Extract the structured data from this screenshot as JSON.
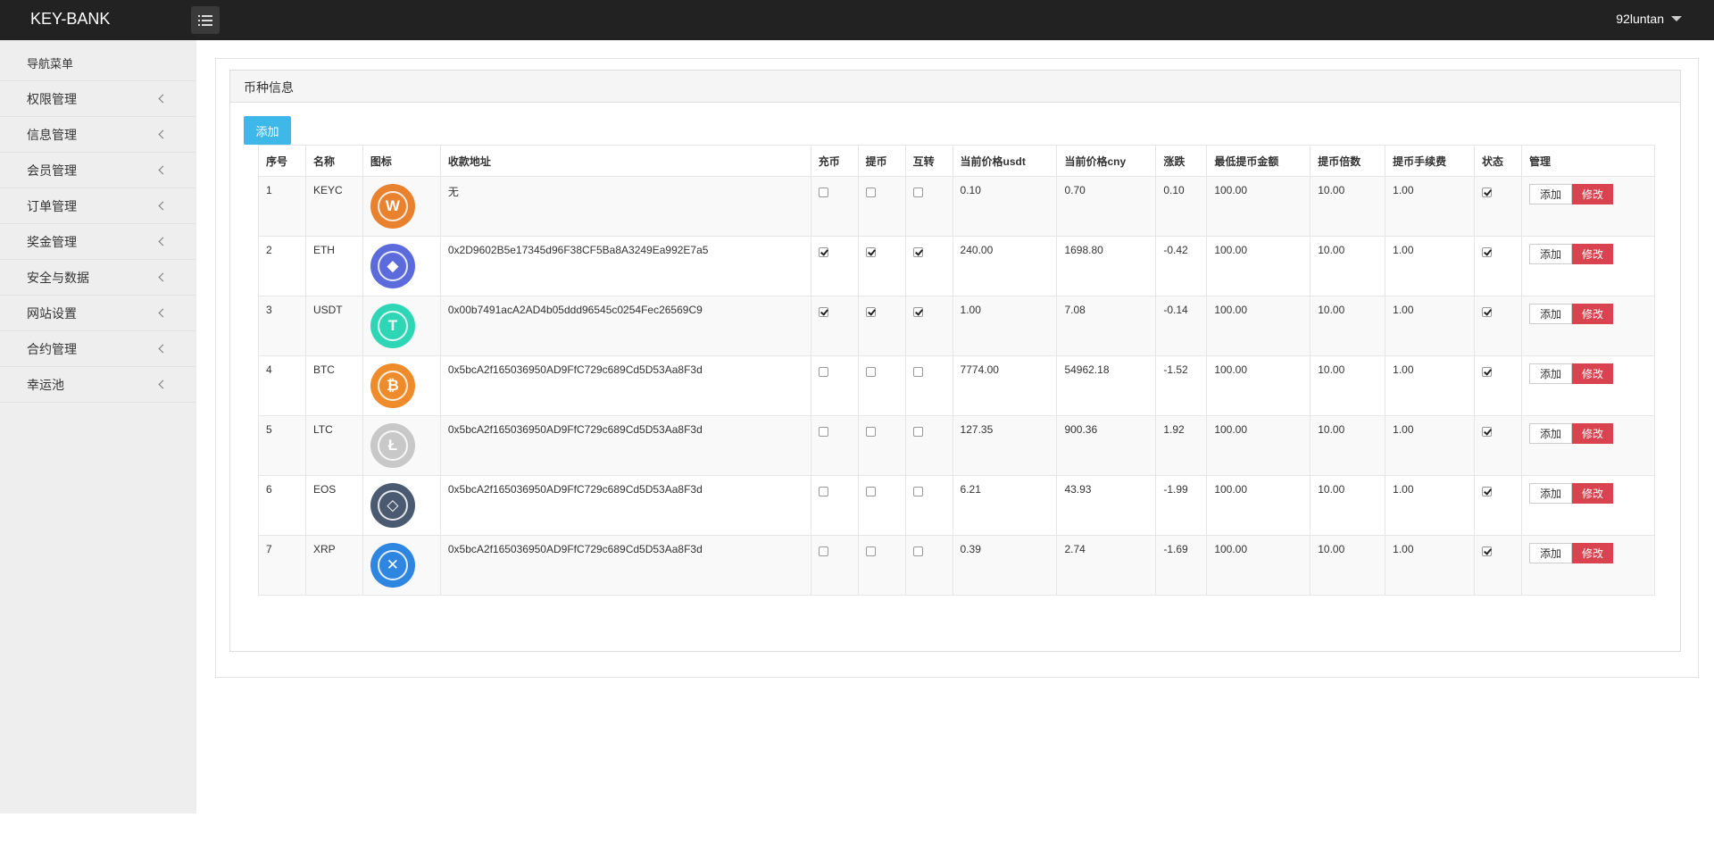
{
  "header": {
    "brand": "KEY-BANK",
    "user": "92luntan"
  },
  "sidebar": {
    "title": "导航菜单",
    "items": [
      {
        "label": "权限管理"
      },
      {
        "label": "信息管理"
      },
      {
        "label": "会员管理"
      },
      {
        "label": "订单管理"
      },
      {
        "label": "奖金管理"
      },
      {
        "label": "安全与数据"
      },
      {
        "label": "网站设置"
      },
      {
        "label": "合约管理"
      },
      {
        "label": "幸运池"
      }
    ]
  },
  "panel": {
    "title": "币种信息",
    "add_label": "添加"
  },
  "table": {
    "columns": [
      "序号",
      "名称",
      "图标",
      "收款地址",
      "充币",
      "提币",
      "互转",
      "当前价格usdt",
      "当前价格cny",
      "涨跌",
      "最低提币金额",
      "提币倍数",
      "提币手续费",
      "状态",
      "管理"
    ],
    "add_label": "添加",
    "edit_label": "修改",
    "rows": [
      {
        "id": "1",
        "name": "KEYC",
        "icon": "keyc-coin-icon",
        "icon_glyph": "W",
        "icon_color": "#e8822e",
        "address": "无",
        "deposit": false,
        "withdraw": false,
        "transfer": false,
        "price_usdt": "0.10",
        "price_cny": "0.70",
        "change": "0.10",
        "min_withdraw": "100.00",
        "multiple": "10.00",
        "fee": "1.00",
        "status": true
      },
      {
        "id": "2",
        "name": "ETH",
        "icon": "eth-coin-icon",
        "icon_glyph": "◆",
        "icon_color": "#5c6bdb",
        "address": "0x2D9602B5e17345d96F38CF5Ba8A3249Ea992E7a5",
        "deposit": true,
        "withdraw": true,
        "transfer": true,
        "price_usdt": "240.00",
        "price_cny": "1698.80",
        "change": "-0.42",
        "min_withdraw": "100.00",
        "multiple": "10.00",
        "fee": "1.00",
        "status": true
      },
      {
        "id": "3",
        "name": "USDT",
        "icon": "usdt-coin-icon",
        "icon_glyph": "T",
        "icon_color": "#2fd6b5",
        "address": "0x00b7491acA2AD4b05ddd96545c0254Fec26569C9",
        "deposit": true,
        "withdraw": true,
        "transfer": true,
        "price_usdt": "1.00",
        "price_cny": "7.08",
        "change": "-0.14",
        "min_withdraw": "100.00",
        "multiple": "10.00",
        "fee": "1.00",
        "status": true
      },
      {
        "id": "4",
        "name": "BTC",
        "icon": "btc-coin-icon",
        "icon_glyph": "₿",
        "icon_color": "#ee8b2b",
        "address": "0x5bcA2f165036950AD9FfC729c689Cd5D53Aa8F3d",
        "deposit": false,
        "withdraw": false,
        "transfer": false,
        "price_usdt": "7774.00",
        "price_cny": "54962.18",
        "change": "-1.52",
        "min_withdraw": "100.00",
        "multiple": "10.00",
        "fee": "1.00",
        "status": true
      },
      {
        "id": "5",
        "name": "LTC",
        "icon": "ltc-coin-icon",
        "icon_glyph": "Ł",
        "icon_color": "#c8c8c8",
        "address": "0x5bcA2f165036950AD9FfC729c689Cd5D53Aa8F3d",
        "deposit": false,
        "withdraw": false,
        "transfer": false,
        "price_usdt": "127.35",
        "price_cny": "900.36",
        "change": "1.92",
        "min_withdraw": "100.00",
        "multiple": "10.00",
        "fee": "1.00",
        "status": true
      },
      {
        "id": "6",
        "name": "EOS",
        "icon": "eos-coin-icon",
        "icon_glyph": "◇",
        "icon_color": "#4a5a70",
        "address": "0x5bcA2f165036950AD9FfC729c689Cd5D53Aa8F3d",
        "deposit": false,
        "withdraw": false,
        "transfer": false,
        "price_usdt": "6.21",
        "price_cny": "43.93",
        "change": "-1.99",
        "min_withdraw": "100.00",
        "multiple": "10.00",
        "fee": "1.00",
        "status": true
      },
      {
        "id": "7",
        "name": "XRP",
        "icon": "xrp-coin-icon",
        "icon_glyph": "✕",
        "icon_color": "#2f86e0",
        "address": "0x5bcA2f165036950AD9FfC729c689Cd5D53Aa8F3d",
        "deposit": false,
        "withdraw": false,
        "transfer": false,
        "price_usdt": "0.39",
        "price_cny": "2.74",
        "change": "-1.69",
        "min_withdraw": "100.00",
        "multiple": "10.00",
        "fee": "1.00",
        "status": true
      }
    ]
  }
}
